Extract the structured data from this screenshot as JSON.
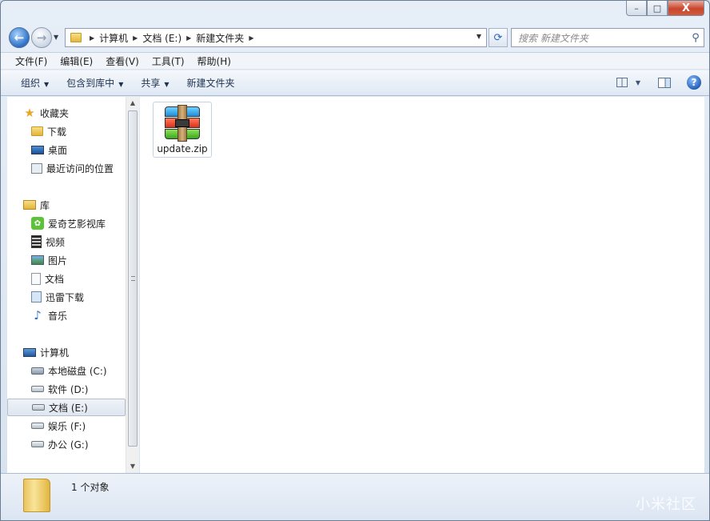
{
  "window": {
    "close_label": "X",
    "max_label": "□",
    "min_label": "–"
  },
  "address": {
    "crumbs": [
      "计算机",
      "文档 (E:)",
      "新建文件夹"
    ]
  },
  "search": {
    "placeholder": "搜索 新建文件夹"
  },
  "menubar": {
    "items": [
      "文件(F)",
      "编辑(E)",
      "查看(V)",
      "工具(T)",
      "帮助(H)"
    ]
  },
  "commandbar": {
    "items": [
      "组织",
      "包含到库中",
      "共享",
      "新建文件夹"
    ]
  },
  "nav": {
    "favorites": {
      "label": "收藏夹",
      "items": [
        "下载",
        "桌面",
        "最近访问的位置"
      ]
    },
    "libraries": {
      "label": "库",
      "items": [
        "爱奇艺影视库",
        "视频",
        "图片",
        "文档",
        "迅雷下载",
        "音乐"
      ]
    },
    "computer": {
      "label": "计算机",
      "items": [
        "本地磁盘 (C:)",
        "软件 (D:)",
        "文档 (E:)",
        "娱乐 (F:)",
        "办公 (G:)"
      ]
    },
    "selected": "文档 (E:)"
  },
  "files": [
    {
      "name": "update.zip",
      "icon": "winrar-archive-icon"
    }
  ],
  "details": {
    "count": "1 个对象"
  },
  "watermark": "小米社区"
}
